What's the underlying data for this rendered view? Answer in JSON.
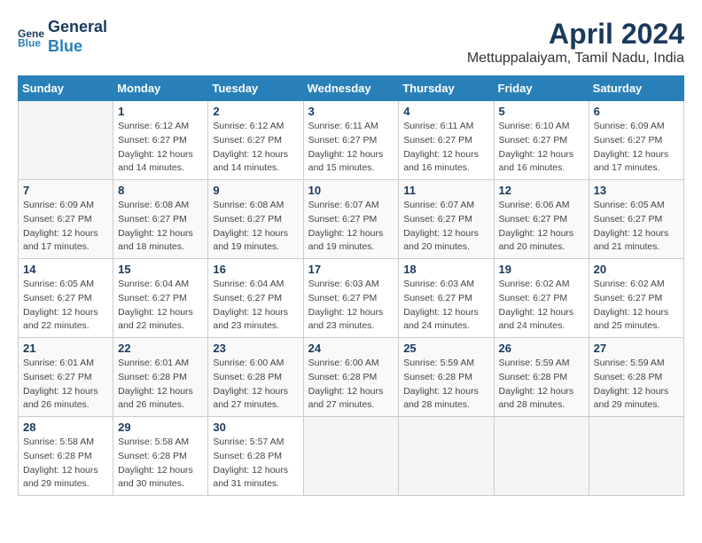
{
  "header": {
    "logo_line1": "General",
    "logo_line2": "Blue",
    "title": "April 2024",
    "subtitle": "Mettuppalaiyam, Tamil Nadu, India"
  },
  "calendar": {
    "days_of_week": [
      "Sunday",
      "Monday",
      "Tuesday",
      "Wednesday",
      "Thursday",
      "Friday",
      "Saturday"
    ],
    "weeks": [
      [
        {
          "day": "",
          "info": ""
        },
        {
          "day": "1",
          "info": "Sunrise: 6:12 AM\nSunset: 6:27 PM\nDaylight: 12 hours\nand 14 minutes."
        },
        {
          "day": "2",
          "info": "Sunrise: 6:12 AM\nSunset: 6:27 PM\nDaylight: 12 hours\nand 14 minutes."
        },
        {
          "day": "3",
          "info": "Sunrise: 6:11 AM\nSunset: 6:27 PM\nDaylight: 12 hours\nand 15 minutes."
        },
        {
          "day": "4",
          "info": "Sunrise: 6:11 AM\nSunset: 6:27 PM\nDaylight: 12 hours\nand 16 minutes."
        },
        {
          "day": "5",
          "info": "Sunrise: 6:10 AM\nSunset: 6:27 PM\nDaylight: 12 hours\nand 16 minutes."
        },
        {
          "day": "6",
          "info": "Sunrise: 6:09 AM\nSunset: 6:27 PM\nDaylight: 12 hours\nand 17 minutes."
        }
      ],
      [
        {
          "day": "7",
          "info": "Sunrise: 6:09 AM\nSunset: 6:27 PM\nDaylight: 12 hours\nand 17 minutes."
        },
        {
          "day": "8",
          "info": "Sunrise: 6:08 AM\nSunset: 6:27 PM\nDaylight: 12 hours\nand 18 minutes."
        },
        {
          "day": "9",
          "info": "Sunrise: 6:08 AM\nSunset: 6:27 PM\nDaylight: 12 hours\nand 19 minutes."
        },
        {
          "day": "10",
          "info": "Sunrise: 6:07 AM\nSunset: 6:27 PM\nDaylight: 12 hours\nand 19 minutes."
        },
        {
          "day": "11",
          "info": "Sunrise: 6:07 AM\nSunset: 6:27 PM\nDaylight: 12 hours\nand 20 minutes."
        },
        {
          "day": "12",
          "info": "Sunrise: 6:06 AM\nSunset: 6:27 PM\nDaylight: 12 hours\nand 20 minutes."
        },
        {
          "day": "13",
          "info": "Sunrise: 6:05 AM\nSunset: 6:27 PM\nDaylight: 12 hours\nand 21 minutes."
        }
      ],
      [
        {
          "day": "14",
          "info": "Sunrise: 6:05 AM\nSunset: 6:27 PM\nDaylight: 12 hours\nand 22 minutes."
        },
        {
          "day": "15",
          "info": "Sunrise: 6:04 AM\nSunset: 6:27 PM\nDaylight: 12 hours\nand 22 minutes."
        },
        {
          "day": "16",
          "info": "Sunrise: 6:04 AM\nSunset: 6:27 PM\nDaylight: 12 hours\nand 23 minutes."
        },
        {
          "day": "17",
          "info": "Sunrise: 6:03 AM\nSunset: 6:27 PM\nDaylight: 12 hours\nand 23 minutes."
        },
        {
          "day": "18",
          "info": "Sunrise: 6:03 AM\nSunset: 6:27 PM\nDaylight: 12 hours\nand 24 minutes."
        },
        {
          "day": "19",
          "info": "Sunrise: 6:02 AM\nSunset: 6:27 PM\nDaylight: 12 hours\nand 24 minutes."
        },
        {
          "day": "20",
          "info": "Sunrise: 6:02 AM\nSunset: 6:27 PM\nDaylight: 12 hours\nand 25 minutes."
        }
      ],
      [
        {
          "day": "21",
          "info": "Sunrise: 6:01 AM\nSunset: 6:27 PM\nDaylight: 12 hours\nand 26 minutes."
        },
        {
          "day": "22",
          "info": "Sunrise: 6:01 AM\nSunset: 6:28 PM\nDaylight: 12 hours\nand 26 minutes."
        },
        {
          "day": "23",
          "info": "Sunrise: 6:00 AM\nSunset: 6:28 PM\nDaylight: 12 hours\nand 27 minutes."
        },
        {
          "day": "24",
          "info": "Sunrise: 6:00 AM\nSunset: 6:28 PM\nDaylight: 12 hours\nand 27 minutes."
        },
        {
          "day": "25",
          "info": "Sunrise: 5:59 AM\nSunset: 6:28 PM\nDaylight: 12 hours\nand 28 minutes."
        },
        {
          "day": "26",
          "info": "Sunrise: 5:59 AM\nSunset: 6:28 PM\nDaylight: 12 hours\nand 28 minutes."
        },
        {
          "day": "27",
          "info": "Sunrise: 5:59 AM\nSunset: 6:28 PM\nDaylight: 12 hours\nand 29 minutes."
        }
      ],
      [
        {
          "day": "28",
          "info": "Sunrise: 5:58 AM\nSunset: 6:28 PM\nDaylight: 12 hours\nand 29 minutes."
        },
        {
          "day": "29",
          "info": "Sunrise: 5:58 AM\nSunset: 6:28 PM\nDaylight: 12 hours\nand 30 minutes."
        },
        {
          "day": "30",
          "info": "Sunrise: 5:57 AM\nSunset: 6:28 PM\nDaylight: 12 hours\nand 31 minutes."
        },
        {
          "day": "",
          "info": ""
        },
        {
          "day": "",
          "info": ""
        },
        {
          "day": "",
          "info": ""
        },
        {
          "day": "",
          "info": ""
        }
      ]
    ]
  }
}
